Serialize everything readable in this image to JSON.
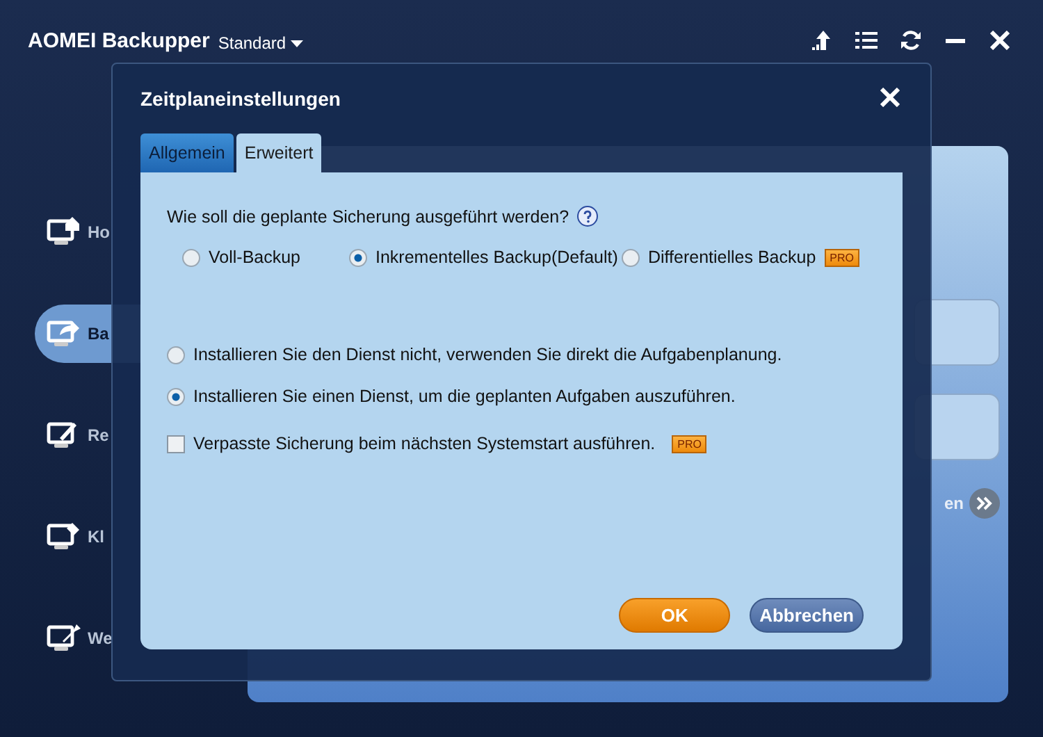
{
  "app": {
    "title": "AOMEI Backupper",
    "edition": "Standard"
  },
  "sidebar": {
    "items": [
      {
        "label": "Ho",
        "selected": false
      },
      {
        "label": "Ba",
        "selected": true
      },
      {
        "label": "Re",
        "selected": false
      },
      {
        "label": "Kl",
        "selected": false
      },
      {
        "label": "We",
        "selected": false
      }
    ]
  },
  "background": {
    "next_button": "en"
  },
  "dialog": {
    "title": "Zeitplaneinstellungen",
    "tabs": [
      {
        "label": "Allgemein",
        "selected": false
      },
      {
        "label": "Erweitert",
        "selected": true
      }
    ],
    "question": "Wie soll die geplante Sicherung ausgeführt werden?",
    "backup_types": [
      {
        "label": "Voll-Backup",
        "selected": false
      },
      {
        "label": "Inkrementelles Backup(Default)",
        "selected": true
      },
      {
        "label": "Differentielles Backup",
        "selected": false,
        "badge": "PRO"
      }
    ],
    "service_options": [
      {
        "label": "Installieren Sie den Dienst nicht, verwenden Sie direkt die Aufgabenplanung.",
        "selected": false
      },
      {
        "label": "Installieren Sie einen Dienst, um die geplanten Aufgaben auszuführen.",
        "selected": true
      }
    ],
    "missed_backup": {
      "label": "Verpasste Sicherung beim nächsten Systemstart ausführen.",
      "checked": false,
      "badge": "PRO"
    },
    "buttons": [
      {
        "label": "OK",
        "kind": "primary"
      },
      {
        "label": "Abbrechen",
        "kind": "secondary"
      }
    ]
  }
}
